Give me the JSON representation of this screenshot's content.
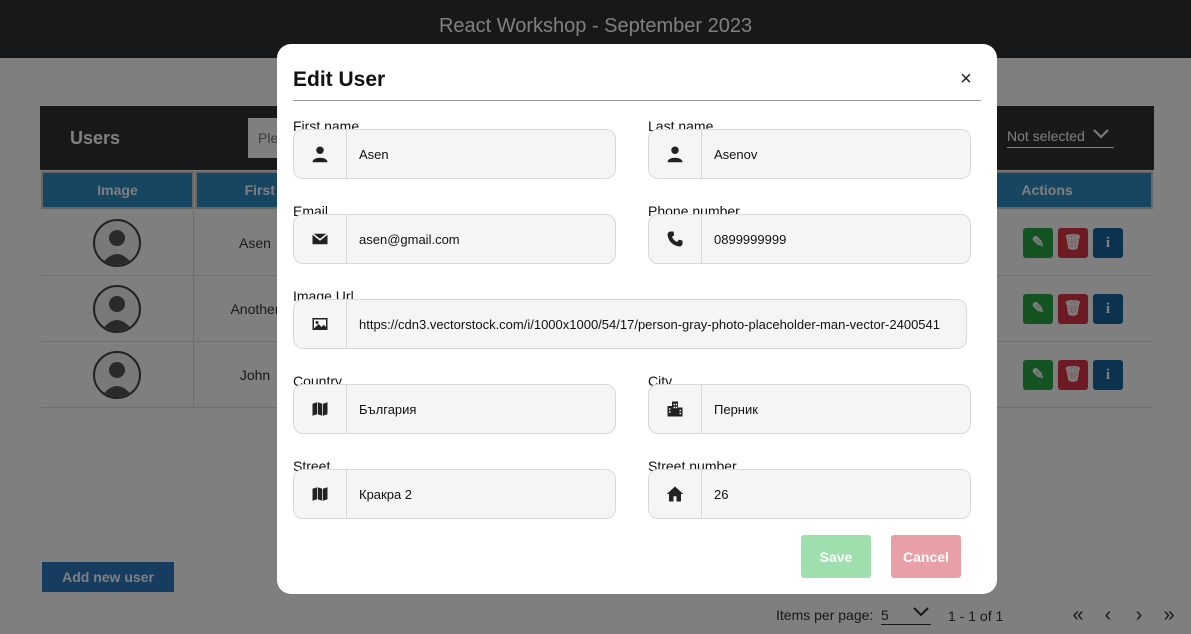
{
  "app": {
    "title": "React Workshop - September 2023"
  },
  "users_panel": {
    "title": "Users",
    "search_placeholder": "Please provide search criteria",
    "sort_value": "Not selected",
    "columns": [
      "Image",
      "First name",
      "Actions"
    ],
    "rows": [
      {
        "first_name": "Asen"
      },
      {
        "first_name": "Another"
      },
      {
        "first_name": "John"
      }
    ],
    "add_user_label": "Add new user"
  },
  "pagination": {
    "items_per_page_label": "Items per page:",
    "items_per_page_value": "5",
    "range": "1 - 1 of 1",
    "first": "«",
    "prev": "‹",
    "next": "›",
    "last": "»"
  },
  "modal": {
    "title": "Edit User",
    "close": "×",
    "fields": {
      "first_name": {
        "label": "First name",
        "value": "Asen",
        "icon": "user-icon"
      },
      "last_name": {
        "label": "Last name",
        "value": "Asenov",
        "icon": "user-icon"
      },
      "email": {
        "label": "Email",
        "value": "asen@gmail.com",
        "icon": "envelope-icon"
      },
      "phone": {
        "label": "Phone number",
        "value": "0899999999",
        "icon": "phone-icon"
      },
      "image_url": {
        "label": "Image Url",
        "value": "https://cdn3.vectorstock.com/i/1000x1000/54/17/person-gray-photo-placeholder-man-vector-2400541",
        "icon": "image-icon"
      },
      "country": {
        "label": "Country",
        "value": "България",
        "icon": "map-icon"
      },
      "city": {
        "label": "City",
        "value": "Перник",
        "icon": "city-icon"
      },
      "street": {
        "label": "Street",
        "value": "Кракра 2",
        "icon": "map-icon"
      },
      "street_number": {
        "label": "Street number",
        "value": "26",
        "icon": "home-icon"
      }
    },
    "save_label": "Save",
    "cancel_label": "Cancel"
  },
  "colors": {
    "header_bg": "#2f3033",
    "table_header": "#2c8cc4",
    "save": "#9fdfae",
    "cancel": "#e8a0a6"
  }
}
